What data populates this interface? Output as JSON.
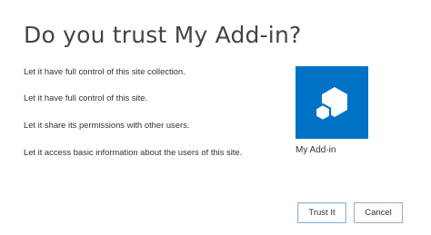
{
  "dialog": {
    "title": "Do you trust My Add-in?",
    "permissions": [
      "Let it have full control of this site collection.",
      "Let it have full control of this site.",
      "Let it share its permissions with other users.",
      "Let it access basic information about the users of this site."
    ],
    "addin": {
      "name": "My Add-in",
      "icon": "add-in-cube-icon",
      "tile_color": "#0072c6"
    },
    "buttons": {
      "trust_label": "Trust It",
      "cancel_label": "Cancel"
    }
  }
}
